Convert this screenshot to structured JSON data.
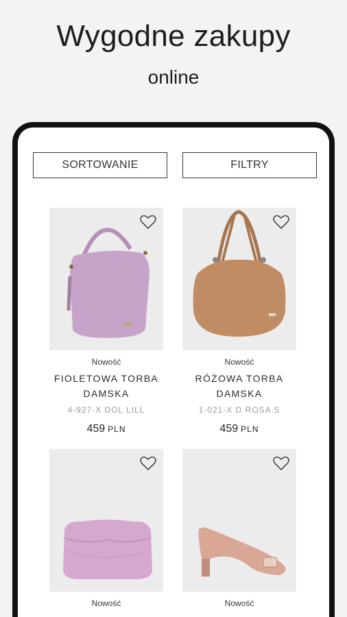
{
  "promo": {
    "headline": "Wygodne zakupy",
    "subline": "online"
  },
  "toolbar": {
    "sort_label": "SORTOWANIE",
    "filter_label": "FILTRY"
  },
  "products": [
    {
      "badge": "Nowość",
      "name_line1": "FIOLETOWA TORBA",
      "name_line2": "DAMSKA",
      "sku": "4-927-X DOL LILL",
      "price": "459",
      "currency": "PLN",
      "image": "purple-handbag",
      "color": "#c7a3c9"
    },
    {
      "badge": "Nowość",
      "name_line1": "RÓŻOWA TORBA",
      "name_line2": "DAMSKA",
      "sku": "1-021-X D ROSA S",
      "price": "459",
      "currency": "PLN",
      "image": "tan-handbag",
      "color": "#c08c63"
    },
    {
      "badge": "Nowość",
      "image": "lilac-clutch",
      "color": "#d4a8cf"
    },
    {
      "badge": "Nowość",
      "image": "nude-pump-shoe",
      "color": "#d9a796"
    }
  ]
}
